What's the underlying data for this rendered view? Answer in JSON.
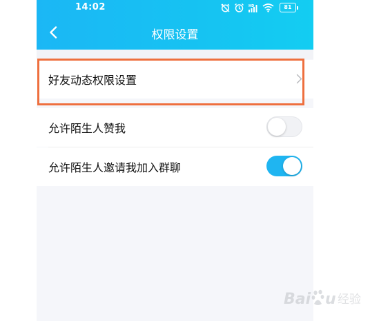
{
  "status_bar": {
    "time": "14:02",
    "battery": "81",
    "signal_badge": "HD",
    "icons": [
      "alarm-sync-icon",
      "alarm-clock-icon",
      "signal-icon",
      "wifi-icon",
      "battery-icon"
    ]
  },
  "header": {
    "title": "权限设置",
    "back_icon": "chevron-left-icon",
    "gradient_start": "#1bb7f5",
    "gradient_end": "#13cdf2"
  },
  "settings": {
    "friends_activity": {
      "label": "好友动态权限设置",
      "icon": "chevron-right-icon"
    },
    "allow_stranger_like": {
      "label": "允许陌生人赞我",
      "enabled": false
    },
    "allow_stranger_invite": {
      "label": "允许陌生人邀请我加入群聊",
      "enabled": true
    }
  },
  "highlight_color": "#ee6f3e",
  "toggle_on_color": "#1fb5f1",
  "watermark": {
    "text": "Baidu",
    "sub": "经验"
  }
}
